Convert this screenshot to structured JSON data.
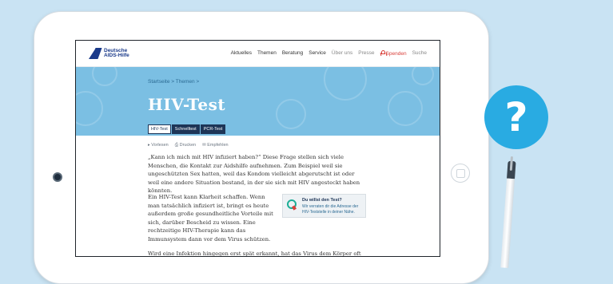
{
  "nav": {
    "logo": "Deutsche\nAIDS-Hilfe",
    "items": [
      "Aktuelles",
      "Themen",
      "Beratung",
      "Service",
      "Über uns",
      "Presse"
    ],
    "donate": "Spenden",
    "search": "Suche"
  },
  "hero": {
    "breadcrumb": "Startseite > Themen >",
    "title": "HIV-Test",
    "tabs": [
      "HIV-Test",
      "Schnelltest",
      "PCR-Test"
    ]
  },
  "tools": [
    "Vorlesen",
    "Drucken",
    "Empfehlen"
  ],
  "content": {
    "p1": "„Kann ich mich mit HIV infiziert haben?“ Diese Frage stellen sich viele Menschen, die Kontakt zur Aidshilfe aufnehmen. Zum Beispiel weil sie ungeschützten Sex hatten, weil das Kondom vielleicht abgerutscht ist oder weil eine andere Situation bestand, in der sie sich mit HIV angesteckt haben könnten.",
    "p2": "Ein HIV-Test kann Klarheit schaffen. Wenn man tatsächlich infiziert ist, bringt es heute außerdem große gesundheitliche Vorteile mit sich, darüber Bescheid zu wissen. Eine rechtzeitige HIV-Therapie kann das Immunsystem dann vor dem Virus schützen.",
    "p3": "Wird eine Infektion hingegen erst spät erkannt, hat das Virus dem Körper oft schon"
  },
  "card": {
    "title": "Du willst den Test?",
    "text": "Wir verraten dir die Adresse der HIV-Teststelle in deiner Nähe."
  },
  "decor": {
    "question_mark": "?"
  },
  "colors": {
    "background": "#c9e3f3",
    "hero": "#7bbfe3",
    "brand": "#1a3a8a",
    "accent_red": "#d9413b",
    "bubble": "#29abe2"
  }
}
